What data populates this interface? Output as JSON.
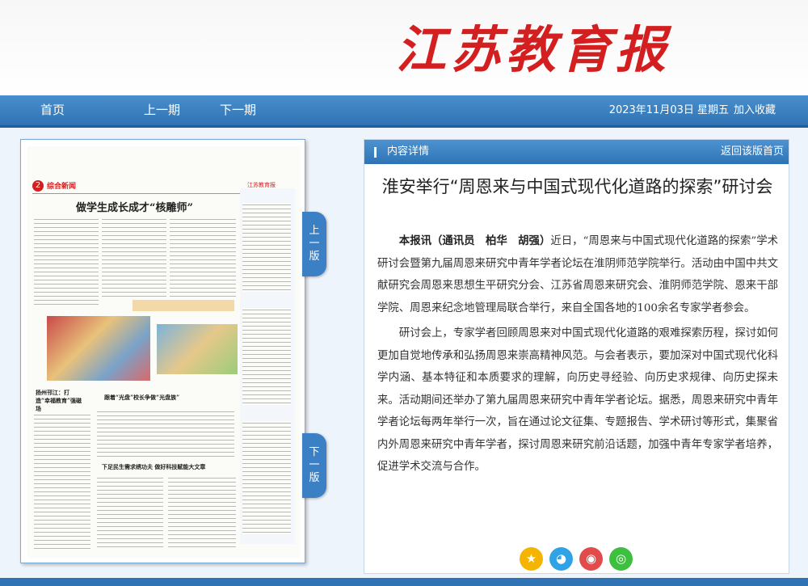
{
  "brand": {
    "logo_text": "江苏教育报"
  },
  "nav": {
    "home": "首页",
    "prev": "上一期",
    "next": "下一期",
    "date": "2023年11月03日 星期五",
    "favorite": "加入收藏"
  },
  "page_preview": {
    "page_number": "2",
    "section": "综合新闻",
    "masthead_small": "江苏教育报",
    "headline": "做学生成长成才“核雕师”",
    "sub_headline_left": "扬州邗江：打造“幸福教育”强磁场",
    "sub_headline_mid": "跟着“光盘”校长争做“光盘族”",
    "sub_headline_bottom": "下足民生需求绣功夫  做好科技赋能大文章"
  },
  "page_tabs": {
    "prev": [
      "上",
      "一",
      "版"
    ],
    "next": [
      "下",
      "一",
      "版"
    ]
  },
  "article": {
    "panel_title": "内容详情",
    "back_link": "返回该版首页",
    "title": "淮安举行“周恩来与中国式现代化道路的探索”研讨会",
    "lead": "本报讯（通讯员　柏华　胡强）",
    "paragraph1": "近日，“周恩来与中国式现代化道路的探索”学术研讨会暨第九届周恩来研究中青年学者论坛在淮阴师范学院举行。活动由中国中共文献研究会周恩来思想生平研究分会、江苏省周恩来研究会、淮阴师范学院、恩来干部学院、周恩来纪念地管理局联合举行，来自全国各地的100余名专家学者参会。",
    "paragraph2": "研讨会上，专家学者回顾周恩来对中国式现代化道路的艰难探索历程，探讨如何更加自觉地传承和弘扬周恩来崇高精神风范。与会者表示，要加深对中国式现代化科学内涵、基本特征和本质要求的理解，向历史寻经验、向历史求规律、向历史探未来。活动期间还举办了第九届周恩来研究中青年学者论坛。据悉，周恩来研究中青年学者论坛每两年举行一次，旨在通过论文征集、专题报告、学术研讨等形式，集聚省内外周恩来研究中青年学者，探讨周恩来研究前沿话题，加强中青年专家学者培养，促进学术交流与合作。"
  },
  "share": {
    "favorite": "★",
    "qq": "◕",
    "weibo": "◉",
    "wechat": "◎"
  },
  "colors": {
    "brand_red": "#d31f1f",
    "nav_blue": "#2f73b4",
    "panel_bg": "#eef4fb"
  }
}
